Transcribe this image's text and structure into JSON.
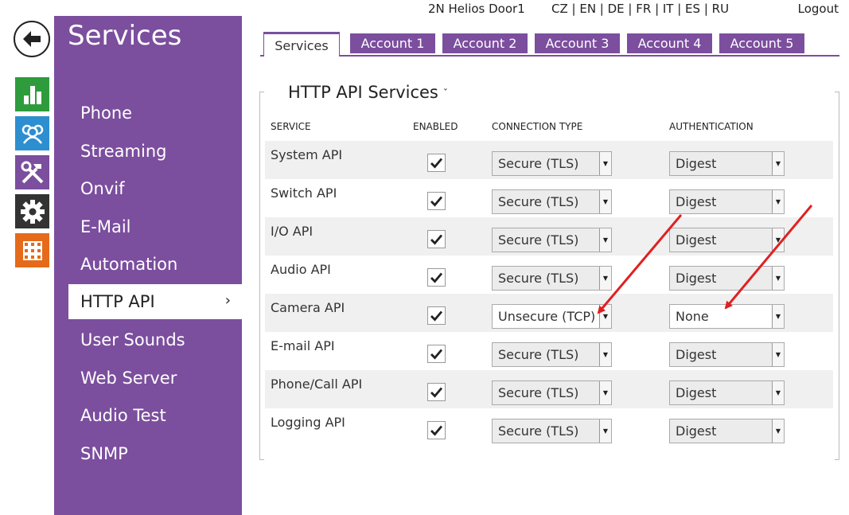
{
  "top": {
    "device_name": "2N Helios Door1",
    "languages": "CZ | EN | DE | FR | IT | ES | RU",
    "logout": "Logout"
  },
  "rail": {
    "back_icon": "back-arrow-icon",
    "icons": [
      {
        "name": "statistics-icon",
        "color": "#2e9c3c"
      },
      {
        "name": "directory-icon",
        "color": "#2d8fd0"
      },
      {
        "name": "hardware-tools-icon",
        "color": "#7b4e9e"
      },
      {
        "name": "settings-gear-icon",
        "color": "#333333"
      },
      {
        "name": "apps-grid-icon",
        "color": "#e56a1a"
      }
    ]
  },
  "sidebar": {
    "title": "Services",
    "accent": "#7b4e9e",
    "items": [
      {
        "label": "Phone"
      },
      {
        "label": "Streaming"
      },
      {
        "label": "Onvif"
      },
      {
        "label": "E-Mail"
      },
      {
        "label": "Automation"
      },
      {
        "label": "HTTP API",
        "active": true
      },
      {
        "label": "User Sounds"
      },
      {
        "label": "Web Server"
      },
      {
        "label": "Audio Test"
      },
      {
        "label": "SNMP"
      }
    ],
    "active_chevron": "›"
  },
  "tabs": [
    {
      "label": "Services",
      "active": true
    },
    {
      "label": "Account 1"
    },
    {
      "label": "Account 2"
    },
    {
      "label": "Account 3"
    },
    {
      "label": "Account 4"
    },
    {
      "label": "Account 5"
    }
  ],
  "panel": {
    "title": "HTTP API Services",
    "caret": "ˇ",
    "headers": {
      "service": "SERVICE",
      "enabled": "ENABLED",
      "connection_type": "CONNECTION TYPE",
      "authentication": "AUTHENTICATION"
    },
    "rows": [
      {
        "service": "System API",
        "enabled": true,
        "connection": "Secure (TLS)",
        "auth": "Digest"
      },
      {
        "service": "Switch API",
        "enabled": true,
        "connection": "Secure (TLS)",
        "auth": "Digest"
      },
      {
        "service": "I/O API",
        "enabled": true,
        "connection": "Secure (TLS)",
        "auth": "Digest"
      },
      {
        "service": "Audio API",
        "enabled": true,
        "connection": "Secure (TLS)",
        "auth": "Digest"
      },
      {
        "service": "Camera API",
        "enabled": true,
        "connection": "Unsecure (TCP)",
        "auth": "None"
      },
      {
        "service": "E-mail API",
        "enabled": true,
        "connection": "Secure (TLS)",
        "auth": "Digest"
      },
      {
        "service": "Phone/Call API",
        "enabled": true,
        "connection": "Secure (TLS)",
        "auth": "Digest"
      },
      {
        "service": "Logging API",
        "enabled": true,
        "connection": "Secure (TLS)",
        "auth": "Digest"
      }
    ]
  },
  "annotation": {
    "arrow_color": "#e02020"
  }
}
